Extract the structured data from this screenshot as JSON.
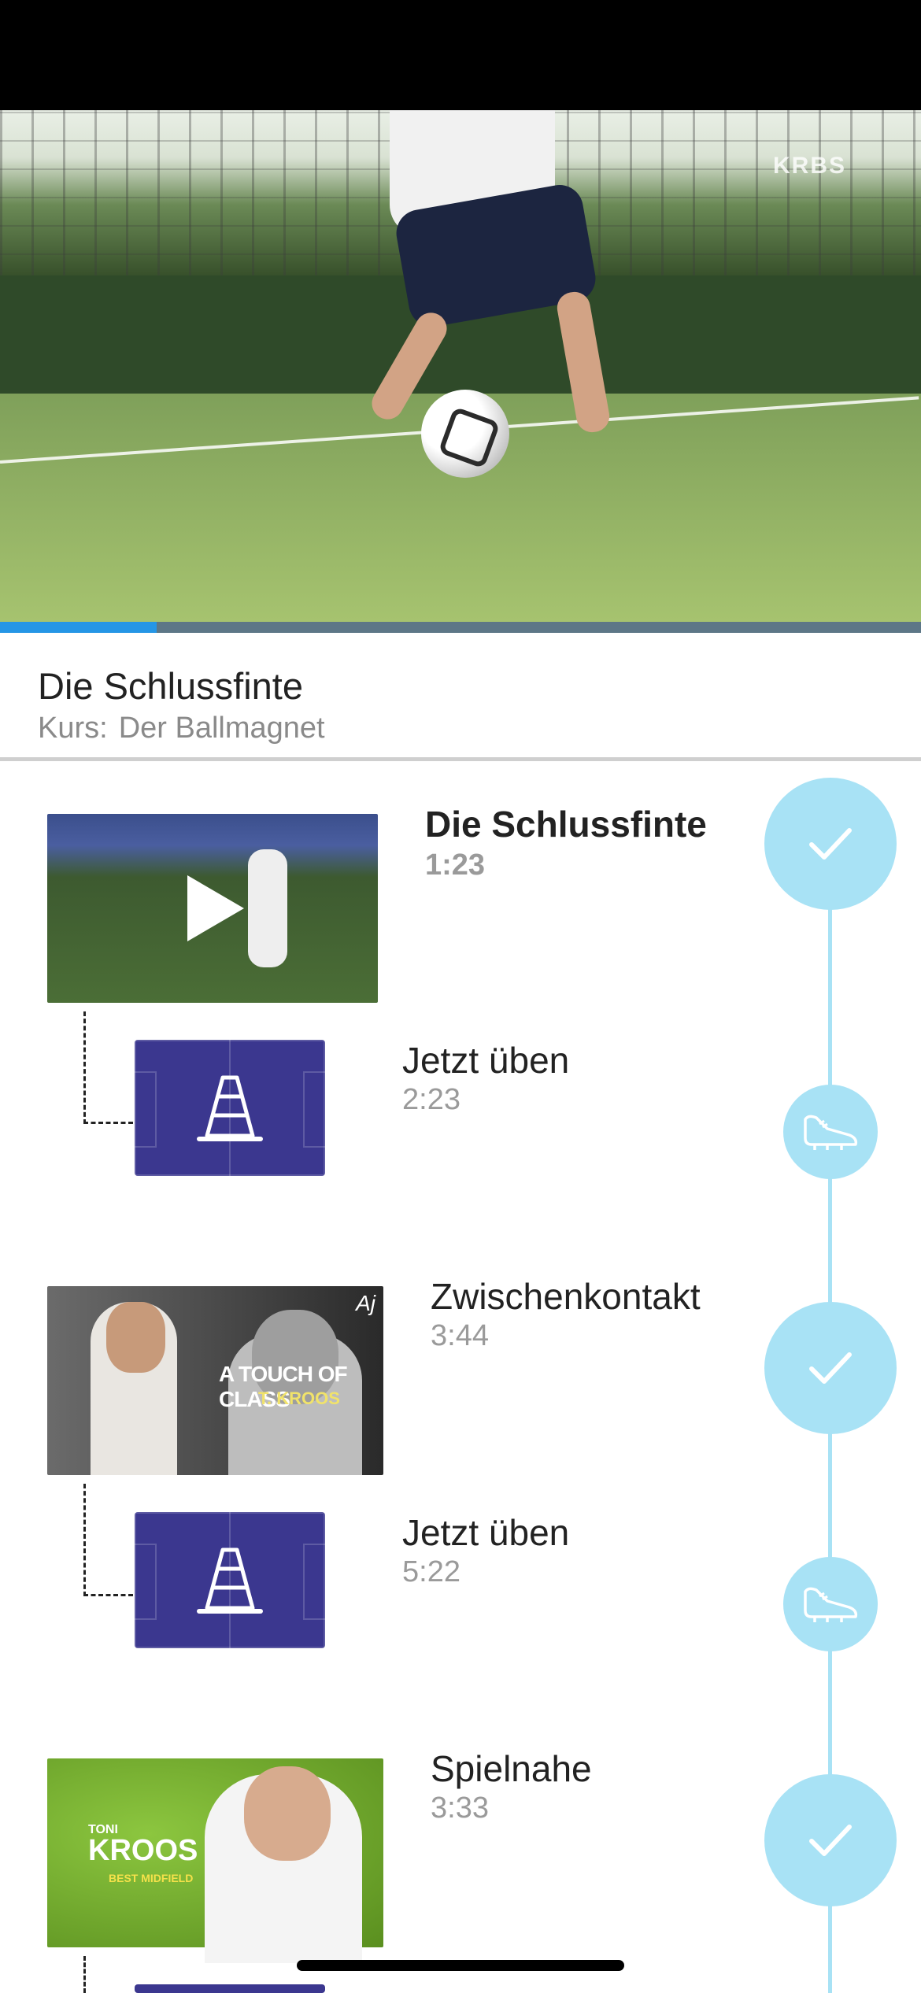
{
  "video": {
    "watermark": "KRBS",
    "progress": 0.17
  },
  "header": {
    "lesson_title": "Die Schlussfinte",
    "course_label": "Kurs:",
    "course_name": "Der Ballmagnet"
  },
  "thumbnails": {
    "zwischenkontakt": {
      "headline": "A TOUCH OF CLASS",
      "subline": "T. KROOS",
      "signature": "Aj"
    },
    "spielnahe": {
      "small": "TONI",
      "big": "KROOS",
      "sub": "BEST MIDFIELD"
    }
  },
  "items": [
    {
      "title": "Die Schlussfinte",
      "time": "1:23",
      "type": "video",
      "status": "completed"
    },
    {
      "title": "Jetzt üben",
      "time": "2:23",
      "type": "drill",
      "icon": "football-boot-icon"
    },
    {
      "title": "Zwischenkontakt",
      "time": "3:44",
      "type": "video",
      "status": "completed"
    },
    {
      "title": "Jetzt üben",
      "time": "5:22",
      "type": "drill",
      "icon": "football-boot-icon"
    },
    {
      "title": "Spielnahe",
      "time": "3:33",
      "type": "video",
      "status": "completed"
    }
  ],
  "colors": {
    "accent": "#2596e6",
    "timeline": "#a8e2f5",
    "drill_bg": "#3b378f"
  }
}
